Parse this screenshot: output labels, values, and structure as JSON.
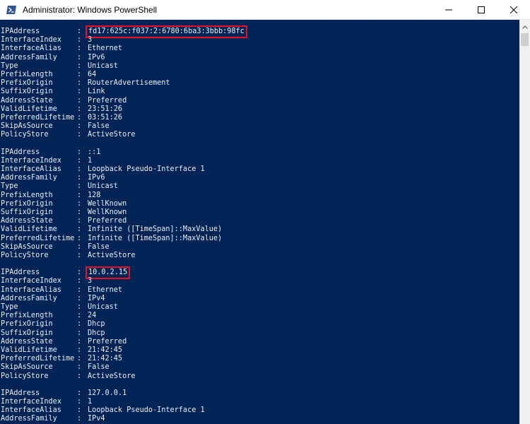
{
  "window": {
    "title": "Administrator: Windows PowerShell"
  },
  "icons": {
    "app": "powershell-icon",
    "minimize": "minimize-icon",
    "maximize": "maximize-icon",
    "close": "close-icon",
    "scroll_up": "chevron-up-icon"
  },
  "colors": {
    "console_bg": "#012456",
    "console_text": "#eeedf0",
    "highlight": "#e81123"
  },
  "console": {
    "blocks": [
      [
        {
          "key": "IPAddress",
          "value": "fd17:625c:f037:2:6780:6ba3:3bbb:98fc",
          "highlight": true
        },
        {
          "key": "InterfaceIndex",
          "value": "3"
        },
        {
          "key": "InterfaceAlias",
          "value": "Ethernet"
        },
        {
          "key": "AddressFamily",
          "value": "IPv6"
        },
        {
          "key": "Type",
          "value": "Unicast"
        },
        {
          "key": "PrefixLength",
          "value": "64"
        },
        {
          "key": "PrefixOrigin",
          "value": "RouterAdvertisement"
        },
        {
          "key": "SuffixOrigin",
          "value": "Link"
        },
        {
          "key": "AddressState",
          "value": "Preferred"
        },
        {
          "key": "ValidLifetime",
          "value": "23:51:26"
        },
        {
          "key": "PreferredLifetime",
          "value": "03:51:26"
        },
        {
          "key": "SkipAsSource",
          "value": "False"
        },
        {
          "key": "PolicyStore",
          "value": "ActiveStore"
        }
      ],
      [
        {
          "key": "IPAddress",
          "value": "::1"
        },
        {
          "key": "InterfaceIndex",
          "value": "1"
        },
        {
          "key": "InterfaceAlias",
          "value": "Loopback Pseudo-Interface 1"
        },
        {
          "key": "AddressFamily",
          "value": "IPv6"
        },
        {
          "key": "Type",
          "value": "Unicast"
        },
        {
          "key": "PrefixLength",
          "value": "128"
        },
        {
          "key": "PrefixOrigin",
          "value": "WellKnown"
        },
        {
          "key": "SuffixOrigin",
          "value": "WellKnown"
        },
        {
          "key": "AddressState",
          "value": "Preferred"
        },
        {
          "key": "ValidLifetime",
          "value": "Infinite ([TimeSpan]::MaxValue)"
        },
        {
          "key": "PreferredLifetime",
          "value": "Infinite ([TimeSpan]::MaxValue)"
        },
        {
          "key": "SkipAsSource",
          "value": "False"
        },
        {
          "key": "PolicyStore",
          "value": "ActiveStore"
        }
      ],
      [
        {
          "key": "IPAddress",
          "value": "10.0.2.15",
          "highlight": true
        },
        {
          "key": "InterfaceIndex",
          "value": "3"
        },
        {
          "key": "InterfaceAlias",
          "value": "Ethernet"
        },
        {
          "key": "AddressFamily",
          "value": "IPv4"
        },
        {
          "key": "Type",
          "value": "Unicast"
        },
        {
          "key": "PrefixLength",
          "value": "24"
        },
        {
          "key": "PrefixOrigin",
          "value": "Dhcp"
        },
        {
          "key": "SuffixOrigin",
          "value": "Dhcp"
        },
        {
          "key": "AddressState",
          "value": "Preferred"
        },
        {
          "key": "ValidLifetime",
          "value": "21:42:45"
        },
        {
          "key": "PreferredLifetime",
          "value": "21:42:45"
        },
        {
          "key": "SkipAsSource",
          "value": "False"
        },
        {
          "key": "PolicyStore",
          "value": "ActiveStore"
        }
      ],
      [
        {
          "key": "IPAddress",
          "value": "127.0.0.1"
        },
        {
          "key": "InterfaceIndex",
          "value": "1"
        },
        {
          "key": "InterfaceAlias",
          "value": "Loopback Pseudo-Interface 1"
        },
        {
          "key": "AddressFamily",
          "value": "IPv4"
        }
      ]
    ]
  }
}
